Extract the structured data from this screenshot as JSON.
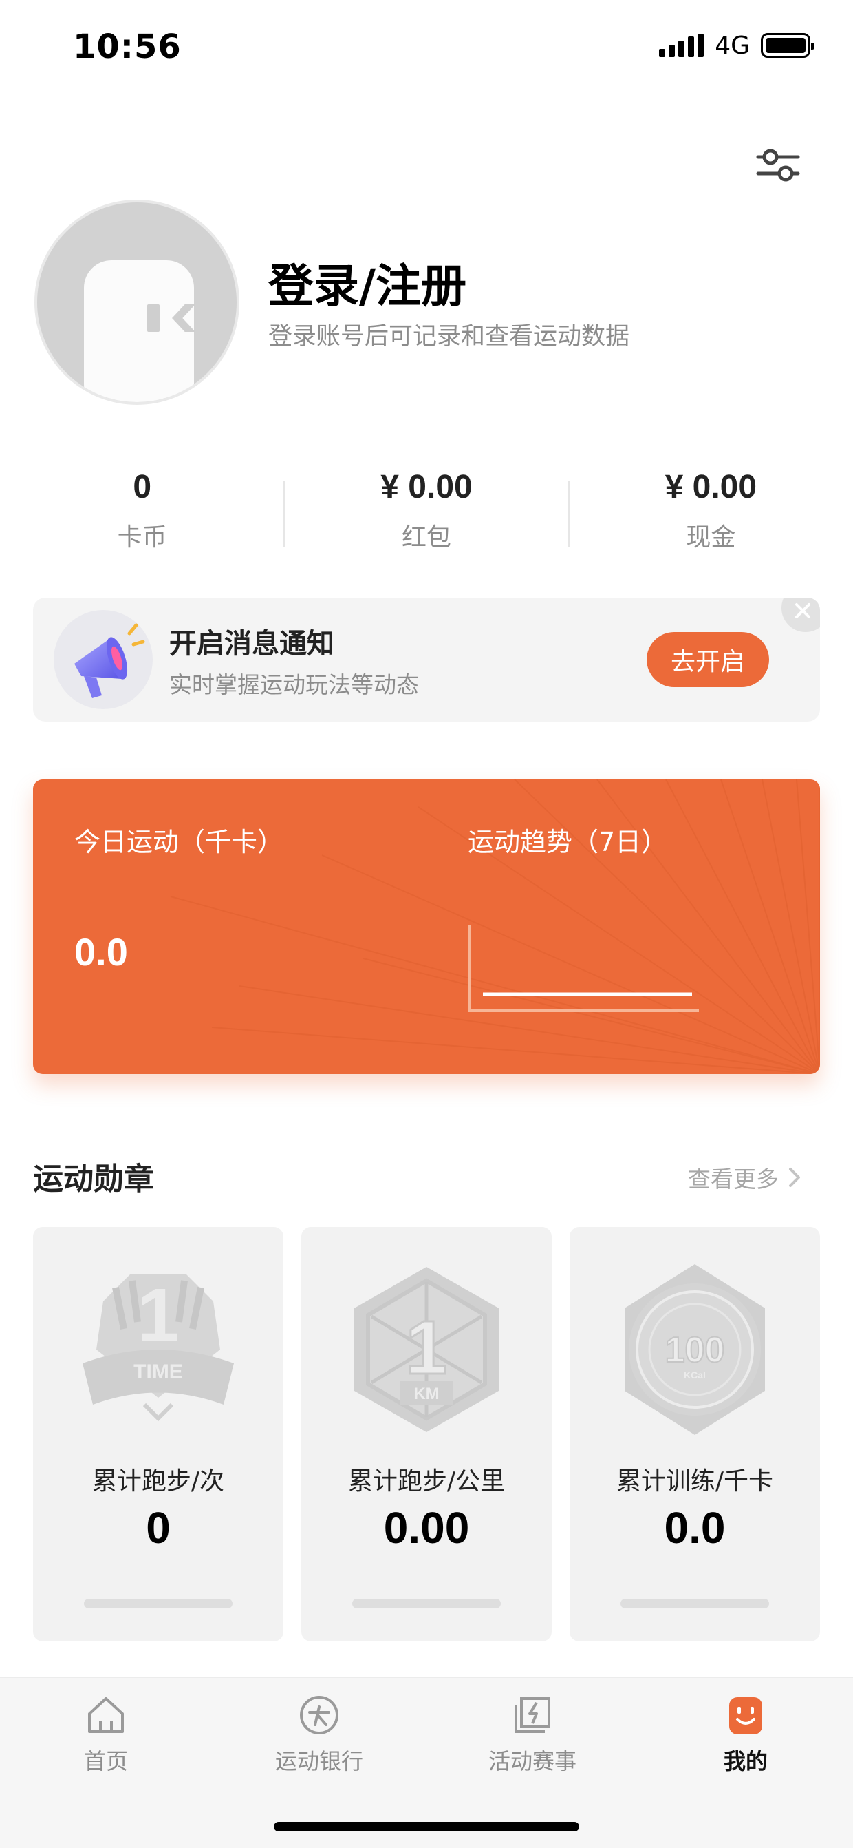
{
  "status_bar": {
    "time": "10:56",
    "network": "4G",
    "battery_level": 1.0
  },
  "header": {
    "settings_icon": "sliders-icon"
  },
  "profile": {
    "avatar_icon": "default-avatar-icon",
    "title": "登录/注册",
    "subtitle": "登录账号后可记录和查看运动数据"
  },
  "stats": [
    {
      "value": "0",
      "label": "卡币"
    },
    {
      "value": "¥ 0.00",
      "label": "红包"
    },
    {
      "value": "¥ 0.00",
      "label": "现金"
    }
  ],
  "notification": {
    "icon": "megaphone-icon",
    "title": "开启消息通知",
    "subtitle": "实时掌握运动玩法等动态",
    "button": "去开启",
    "close_icon": "close-icon"
  },
  "activity": {
    "today_label": "今日运动（千卡）",
    "today_value": "0.0",
    "trend_label": "运动趋势（7日）",
    "chart_data": {
      "type": "line",
      "x": [
        1,
        2,
        3,
        4,
        5,
        6,
        7
      ],
      "values": [
        0,
        0,
        0,
        0,
        0,
        0,
        0
      ]
    },
    "colors": {
      "card": "#ec6a39",
      "line": "#ffffff"
    }
  },
  "medals": {
    "title": "运动勋章",
    "see_more": "查看更多",
    "items": [
      {
        "icon": "run-count-badge-icon",
        "badge_text": "TIME",
        "badge_num": "1",
        "name": "累计跑步/次",
        "value": "0"
      },
      {
        "icon": "run-km-badge-icon",
        "badge_text": "KM",
        "badge_num": "1",
        "name": "累计跑步/公里",
        "value": "0.00"
      },
      {
        "icon": "training-kcal-badge-icon",
        "badge_text": "KCal",
        "badge_num": "100",
        "name": "累计训练/千卡",
        "value": "0.0"
      }
    ]
  },
  "tabbar": {
    "items": [
      {
        "icon": "home-icon",
        "label": "首页",
        "active": false
      },
      {
        "icon": "sport-bank-icon",
        "label": "运动银行",
        "active": false
      },
      {
        "icon": "event-icon",
        "label": "活动赛事",
        "active": false
      },
      {
        "icon": "mine-icon",
        "label": "我的",
        "active": true
      }
    ],
    "active_color": "#ec6a39"
  }
}
